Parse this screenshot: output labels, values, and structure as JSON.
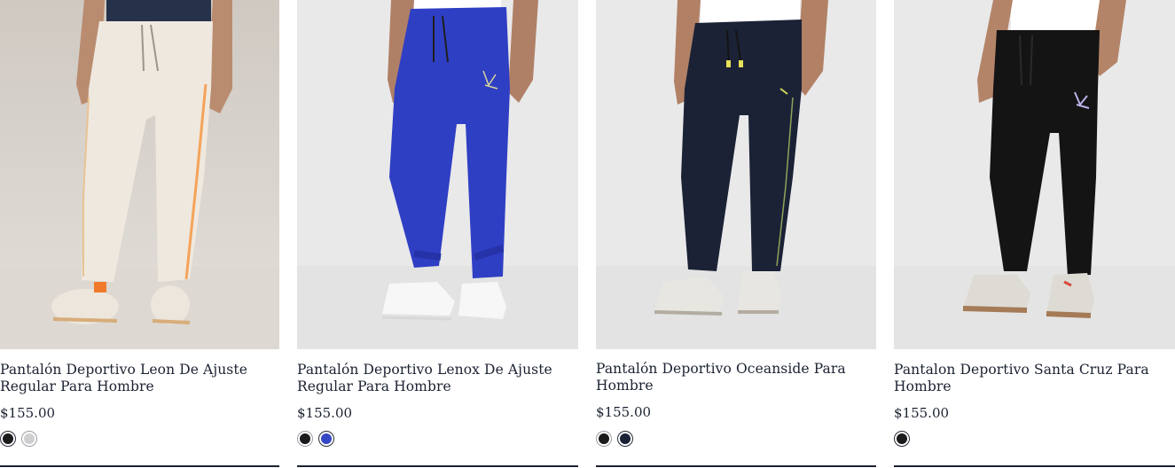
{
  "products": [
    {
      "title": "Pantalón Deportivo Leon De Ajuste Regular Para Hombre",
      "price": "$155.00",
      "swatches": [
        "#1b1b1b",
        "#cfcfcf"
      ],
      "image_icon": "beige-jogger-photo"
    },
    {
      "title": "Pantalón Deportivo Lenox De Ajuste Regular Para Hombre",
      "price": "$155.00",
      "swatches": [
        "#1b1b1b",
        "#3647c5"
      ],
      "image_icon": "blue-jogger-photo"
    },
    {
      "title": "Pantalón Deportivo Oceanside Para Hombre",
      "price": "$155.00",
      "swatches": [
        "#1b1b1b",
        "#1a2236"
      ],
      "image_icon": "navy-jogger-photo"
    },
    {
      "title": "Pantalon Deportivo Santa Cruz Para Hombre",
      "price": "$155.00",
      "swatches": [
        "#1b1b1b"
      ],
      "image_icon": "black-jogger-photo"
    }
  ]
}
